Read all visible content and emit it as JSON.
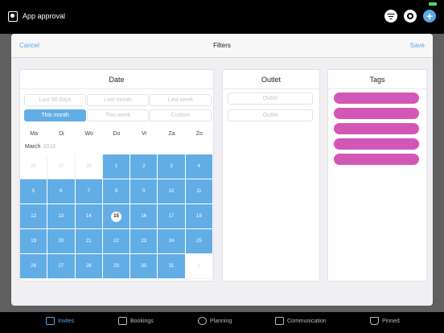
{
  "app": {
    "title": "App approval"
  },
  "modal": {
    "cancel": "Cancel",
    "title": "Filters",
    "save": "Save"
  },
  "date": {
    "title": "Date",
    "presets": [
      {
        "label": "Last 90 days",
        "active": false
      },
      {
        "label": "Last month",
        "active": false
      },
      {
        "label": "Last week",
        "active": false
      },
      {
        "label": "This month",
        "active": true
      },
      {
        "label": "This week",
        "active": false
      },
      {
        "label": "Custom",
        "active": false
      }
    ],
    "weekdays": [
      "Ma",
      "Di",
      "Wo",
      "Do",
      "Vr",
      "Za",
      "Zo"
    ],
    "month": "March",
    "year": "2018",
    "days": [
      {
        "d": "26",
        "sel": false
      },
      {
        "d": "27",
        "sel": false
      },
      {
        "d": "28",
        "sel": false
      },
      {
        "d": "1",
        "sel": true
      },
      {
        "d": "2",
        "sel": true
      },
      {
        "d": "3",
        "sel": true
      },
      {
        "d": "4",
        "sel": true
      },
      {
        "d": "5",
        "sel": true
      },
      {
        "d": "6",
        "sel": true
      },
      {
        "d": "7",
        "sel": true
      },
      {
        "d": "8",
        "sel": true
      },
      {
        "d": "9",
        "sel": true
      },
      {
        "d": "10",
        "sel": true
      },
      {
        "d": "11",
        "sel": true
      },
      {
        "d": "12",
        "sel": true
      },
      {
        "d": "13",
        "sel": true
      },
      {
        "d": "14",
        "sel": true
      },
      {
        "d": "15",
        "sel": true,
        "today": true
      },
      {
        "d": "16",
        "sel": true
      },
      {
        "d": "17",
        "sel": true
      },
      {
        "d": "18",
        "sel": true
      },
      {
        "d": "19",
        "sel": true
      },
      {
        "d": "20",
        "sel": true
      },
      {
        "d": "21",
        "sel": true
      },
      {
        "d": "22",
        "sel": true
      },
      {
        "d": "23",
        "sel": true
      },
      {
        "d": "24",
        "sel": true
      },
      {
        "d": "25",
        "sel": true
      },
      {
        "d": "26",
        "sel": true
      },
      {
        "d": "27",
        "sel": true
      },
      {
        "d": "28",
        "sel": true
      },
      {
        "d": "29",
        "sel": true
      },
      {
        "d": "30",
        "sel": true
      },
      {
        "d": "31",
        "sel": true
      },
      {
        "d": "1",
        "sel": false
      }
    ]
  },
  "outlet": {
    "title": "Outlet",
    "inputs": [
      "Outlet",
      "Outlet"
    ]
  },
  "tags": {
    "title": "Tags",
    "count": 5,
    "color": "#d357b6"
  },
  "tabs": [
    {
      "label": "Invites",
      "icon": "mail-icon",
      "active": true
    },
    {
      "label": "Bookings",
      "icon": "book-icon",
      "active": false
    },
    {
      "label": "Planning",
      "icon": "clock-icon",
      "active": false
    },
    {
      "label": "Communication",
      "icon": "chat-icon",
      "active": false
    },
    {
      "label": "Pinned",
      "icon": "pin-icon",
      "active": false
    }
  ],
  "colors": {
    "accent": "#5aa8e6",
    "selected": "#62ade6",
    "tag": "#d357b6"
  }
}
